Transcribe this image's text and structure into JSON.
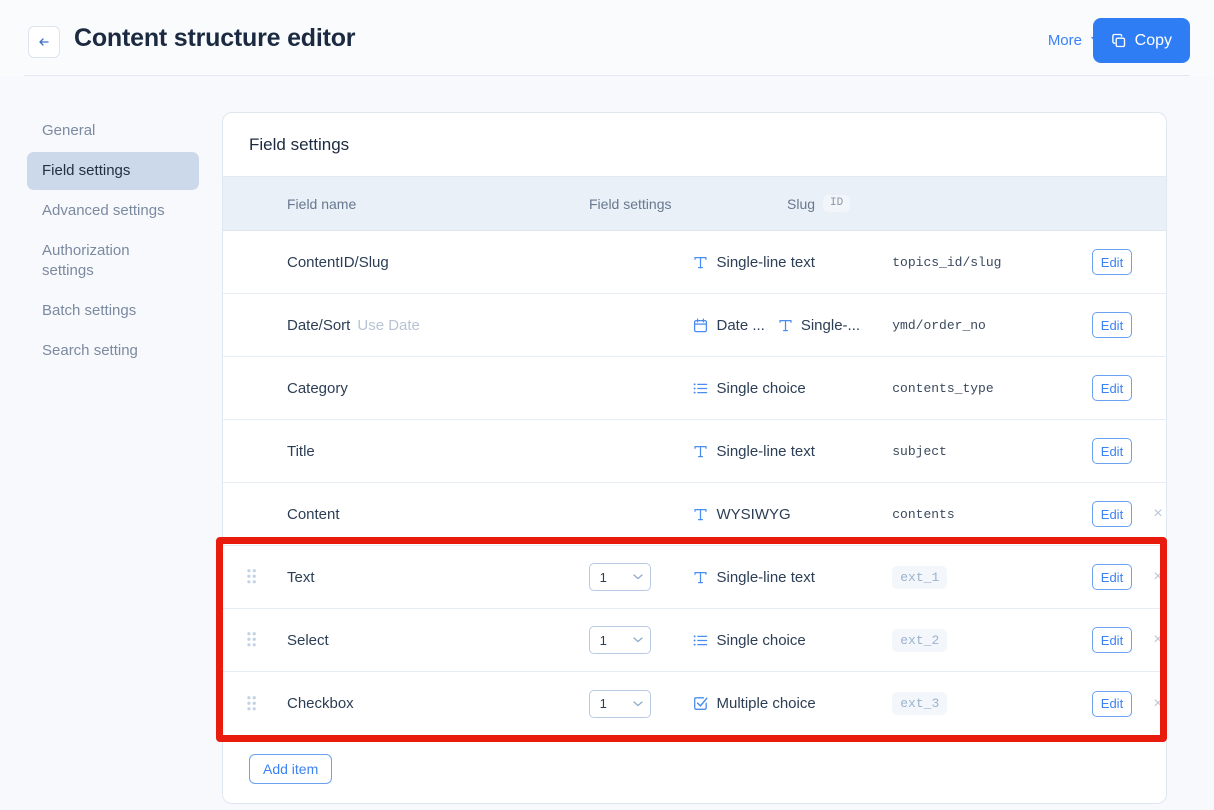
{
  "header": {
    "title": "Content structure editor",
    "back_icon": "arrow-left-icon",
    "more_label": "More",
    "more_caret": "chevron-down-icon",
    "copy_label": "Copy",
    "copy_icon": "copy-icon",
    "copy_color": "#2f7df4"
  },
  "sidebar": {
    "items": [
      {
        "label": "General",
        "active": false
      },
      {
        "label": "Field settings",
        "active": true
      },
      {
        "label": "Advanced settings",
        "active": false
      },
      {
        "label": "Authorization settings",
        "active": false
      },
      {
        "label": "Batch settings",
        "active": false
      },
      {
        "label": "Search setting",
        "active": false
      }
    ],
    "active_bg": "#ccd9ea"
  },
  "card": {
    "title": "Field settings",
    "columns": {
      "field_name": "Field name",
      "field_settings": "Field settings",
      "slug": "Slug",
      "slug_badge": "ID"
    },
    "add_item_label": "Add item",
    "edit_label": "Edit",
    "delete_icon": "close-icon",
    "drag_icon": "drag-handle-icon",
    "rows": [
      {
        "name": "ContentID/Slug",
        "name_sub": "",
        "has_handle": false,
        "number": null,
        "settings": [
          {
            "icon": "text-t-icon",
            "label": "Single-line text"
          }
        ],
        "slug": "topics_id/slug",
        "slug_placeholder": false,
        "edit": "Edit",
        "deletable": false,
        "highlighted": false
      },
      {
        "name": "Date/Sort",
        "name_sub": "Use Date",
        "has_handle": false,
        "number": null,
        "settings": [
          {
            "icon": "calendar-icon",
            "label": "Date ..."
          },
          {
            "icon": "text-t-icon",
            "label": "Single-..."
          }
        ],
        "slug": "ymd/order_no",
        "slug_placeholder": false,
        "edit": "Edit",
        "deletable": false,
        "highlighted": false
      },
      {
        "name": "Category",
        "name_sub": "",
        "has_handle": false,
        "number": null,
        "settings": [
          {
            "icon": "list-icon",
            "label": "Single choice"
          }
        ],
        "slug": "contents_type",
        "slug_placeholder": false,
        "edit": "Edit",
        "deletable": false,
        "highlighted": false
      },
      {
        "name": "Title",
        "name_sub": "",
        "has_handle": false,
        "number": null,
        "settings": [
          {
            "icon": "text-t-icon",
            "label": "Single-line text"
          }
        ],
        "slug": "subject",
        "slug_placeholder": false,
        "edit": "Edit",
        "deletable": false,
        "highlighted": false
      },
      {
        "name": "Content",
        "name_sub": "",
        "has_handle": false,
        "number": null,
        "settings": [
          {
            "icon": "text-t-icon",
            "label": "WYSIWYG"
          }
        ],
        "slug": "contents",
        "slug_placeholder": false,
        "edit": "Edit",
        "deletable": true,
        "highlighted": false
      },
      {
        "name": "Text",
        "name_sub": "",
        "has_handle": true,
        "number": "1",
        "settings": [
          {
            "icon": "text-t-icon",
            "label": "Single-line text"
          }
        ],
        "slug": "ext_1",
        "slug_placeholder": true,
        "edit": "Edit",
        "deletable": true,
        "highlighted": true
      },
      {
        "name": "Select",
        "name_sub": "",
        "has_handle": true,
        "number": "1",
        "settings": [
          {
            "icon": "list-icon",
            "label": "Single choice"
          }
        ],
        "slug": "ext_2",
        "slug_placeholder": true,
        "edit": "Edit",
        "deletable": true,
        "highlighted": true
      },
      {
        "name": "Checkbox",
        "name_sub": "",
        "has_handle": true,
        "number": "1",
        "settings": [
          {
            "icon": "checkbox-check-icon",
            "label": "Multiple choice"
          }
        ],
        "slug": "ext_3",
        "slug_placeholder": true,
        "edit": "Edit",
        "deletable": true,
        "highlighted": true
      }
    ]
  },
  "annotation": {
    "highlight_color": "#e81b0d",
    "highlight_rows": [
      "Text",
      "Select",
      "Checkbox"
    ]
  }
}
